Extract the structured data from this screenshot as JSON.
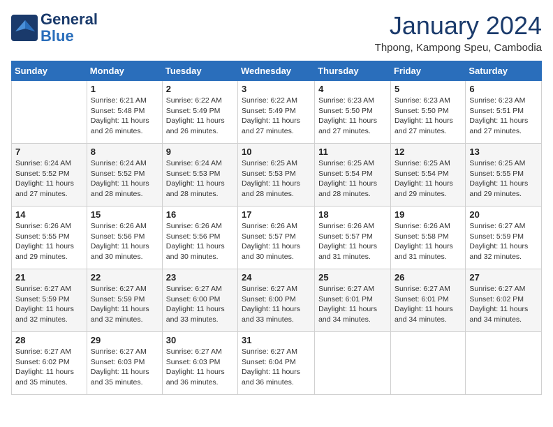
{
  "header": {
    "logo_line1": "General",
    "logo_line2": "Blue",
    "month_title": "January 2024",
    "location": "Thpong, Kampong Speu, Cambodia"
  },
  "weekdays": [
    "Sunday",
    "Monday",
    "Tuesday",
    "Wednesday",
    "Thursday",
    "Friday",
    "Saturday"
  ],
  "weeks": [
    [
      {
        "day": "",
        "sunrise": "",
        "sunset": "",
        "daylight": ""
      },
      {
        "day": "1",
        "sunrise": "Sunrise: 6:21 AM",
        "sunset": "Sunset: 5:48 PM",
        "daylight": "Daylight: 11 hours and 26 minutes."
      },
      {
        "day": "2",
        "sunrise": "Sunrise: 6:22 AM",
        "sunset": "Sunset: 5:49 PM",
        "daylight": "Daylight: 11 hours and 26 minutes."
      },
      {
        "day": "3",
        "sunrise": "Sunrise: 6:22 AM",
        "sunset": "Sunset: 5:49 PM",
        "daylight": "Daylight: 11 hours and 27 minutes."
      },
      {
        "day": "4",
        "sunrise": "Sunrise: 6:23 AM",
        "sunset": "Sunset: 5:50 PM",
        "daylight": "Daylight: 11 hours and 27 minutes."
      },
      {
        "day": "5",
        "sunrise": "Sunrise: 6:23 AM",
        "sunset": "Sunset: 5:50 PM",
        "daylight": "Daylight: 11 hours and 27 minutes."
      },
      {
        "day": "6",
        "sunrise": "Sunrise: 6:23 AM",
        "sunset": "Sunset: 5:51 PM",
        "daylight": "Daylight: 11 hours and 27 minutes."
      }
    ],
    [
      {
        "day": "7",
        "sunrise": "Sunrise: 6:24 AM",
        "sunset": "Sunset: 5:52 PM",
        "daylight": "Daylight: 11 hours and 27 minutes."
      },
      {
        "day": "8",
        "sunrise": "Sunrise: 6:24 AM",
        "sunset": "Sunset: 5:52 PM",
        "daylight": "Daylight: 11 hours and 28 minutes."
      },
      {
        "day": "9",
        "sunrise": "Sunrise: 6:24 AM",
        "sunset": "Sunset: 5:53 PM",
        "daylight": "Daylight: 11 hours and 28 minutes."
      },
      {
        "day": "10",
        "sunrise": "Sunrise: 6:25 AM",
        "sunset": "Sunset: 5:53 PM",
        "daylight": "Daylight: 11 hours and 28 minutes."
      },
      {
        "day": "11",
        "sunrise": "Sunrise: 6:25 AM",
        "sunset": "Sunset: 5:54 PM",
        "daylight": "Daylight: 11 hours and 28 minutes."
      },
      {
        "day": "12",
        "sunrise": "Sunrise: 6:25 AM",
        "sunset": "Sunset: 5:54 PM",
        "daylight": "Daylight: 11 hours and 29 minutes."
      },
      {
        "day": "13",
        "sunrise": "Sunrise: 6:25 AM",
        "sunset": "Sunset: 5:55 PM",
        "daylight": "Daylight: 11 hours and 29 minutes."
      }
    ],
    [
      {
        "day": "14",
        "sunrise": "Sunrise: 6:26 AM",
        "sunset": "Sunset: 5:55 PM",
        "daylight": "Daylight: 11 hours and 29 minutes."
      },
      {
        "day": "15",
        "sunrise": "Sunrise: 6:26 AM",
        "sunset": "Sunset: 5:56 PM",
        "daylight": "Daylight: 11 hours and 30 minutes."
      },
      {
        "day": "16",
        "sunrise": "Sunrise: 6:26 AM",
        "sunset": "Sunset: 5:56 PM",
        "daylight": "Daylight: 11 hours and 30 minutes."
      },
      {
        "day": "17",
        "sunrise": "Sunrise: 6:26 AM",
        "sunset": "Sunset: 5:57 PM",
        "daylight": "Daylight: 11 hours and 30 minutes."
      },
      {
        "day": "18",
        "sunrise": "Sunrise: 6:26 AM",
        "sunset": "Sunset: 5:57 PM",
        "daylight": "Daylight: 11 hours and 31 minutes."
      },
      {
        "day": "19",
        "sunrise": "Sunrise: 6:26 AM",
        "sunset": "Sunset: 5:58 PM",
        "daylight": "Daylight: 11 hours and 31 minutes."
      },
      {
        "day": "20",
        "sunrise": "Sunrise: 6:27 AM",
        "sunset": "Sunset: 5:59 PM",
        "daylight": "Daylight: 11 hours and 32 minutes."
      }
    ],
    [
      {
        "day": "21",
        "sunrise": "Sunrise: 6:27 AM",
        "sunset": "Sunset: 5:59 PM",
        "daylight": "Daylight: 11 hours and 32 minutes."
      },
      {
        "day": "22",
        "sunrise": "Sunrise: 6:27 AM",
        "sunset": "Sunset: 5:59 PM",
        "daylight": "Daylight: 11 hours and 32 minutes."
      },
      {
        "day": "23",
        "sunrise": "Sunrise: 6:27 AM",
        "sunset": "Sunset: 6:00 PM",
        "daylight": "Daylight: 11 hours and 33 minutes."
      },
      {
        "day": "24",
        "sunrise": "Sunrise: 6:27 AM",
        "sunset": "Sunset: 6:00 PM",
        "daylight": "Daylight: 11 hours and 33 minutes."
      },
      {
        "day": "25",
        "sunrise": "Sunrise: 6:27 AM",
        "sunset": "Sunset: 6:01 PM",
        "daylight": "Daylight: 11 hours and 34 minutes."
      },
      {
        "day": "26",
        "sunrise": "Sunrise: 6:27 AM",
        "sunset": "Sunset: 6:01 PM",
        "daylight": "Daylight: 11 hours and 34 minutes."
      },
      {
        "day": "27",
        "sunrise": "Sunrise: 6:27 AM",
        "sunset": "Sunset: 6:02 PM",
        "daylight": "Daylight: 11 hours and 34 minutes."
      }
    ],
    [
      {
        "day": "28",
        "sunrise": "Sunrise: 6:27 AM",
        "sunset": "Sunset: 6:02 PM",
        "daylight": "Daylight: 11 hours and 35 minutes."
      },
      {
        "day": "29",
        "sunrise": "Sunrise: 6:27 AM",
        "sunset": "Sunset: 6:03 PM",
        "daylight": "Daylight: 11 hours and 35 minutes."
      },
      {
        "day": "30",
        "sunrise": "Sunrise: 6:27 AM",
        "sunset": "Sunset: 6:03 PM",
        "daylight": "Daylight: 11 hours and 36 minutes."
      },
      {
        "day": "31",
        "sunrise": "Sunrise: 6:27 AM",
        "sunset": "Sunset: 6:04 PM",
        "daylight": "Daylight: 11 hours and 36 minutes."
      },
      {
        "day": "",
        "sunrise": "",
        "sunset": "",
        "daylight": ""
      },
      {
        "day": "",
        "sunrise": "",
        "sunset": "",
        "daylight": ""
      },
      {
        "day": "",
        "sunrise": "",
        "sunset": "",
        "daylight": ""
      }
    ]
  ]
}
